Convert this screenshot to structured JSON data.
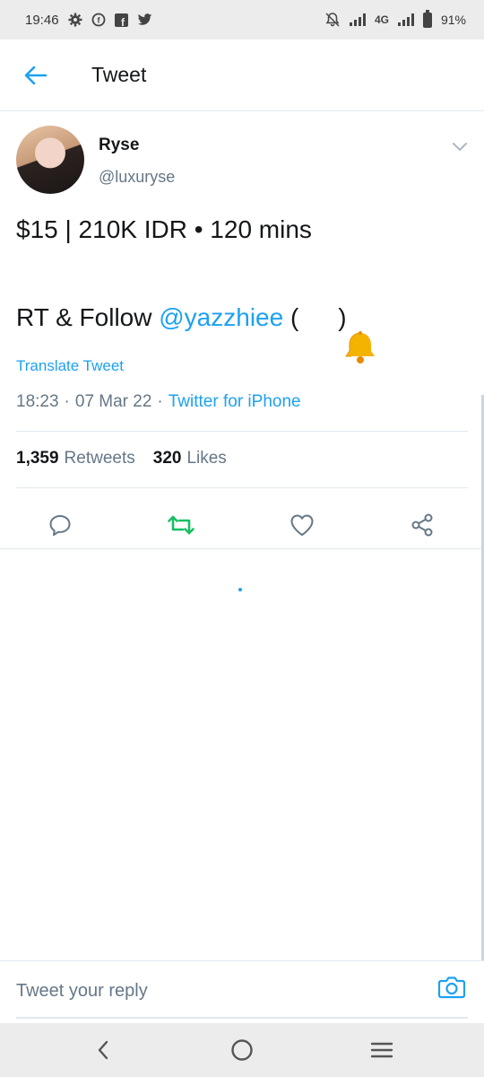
{
  "status_bar": {
    "time": "19:46",
    "network": "4G",
    "battery": "91%",
    "icons": [
      "gear-icon",
      "facebook-messenger-icon",
      "facebook-icon",
      "twitter-icon",
      "mute-icon",
      "signal-icon",
      "battery-icon"
    ]
  },
  "header": {
    "title": "Tweet"
  },
  "tweet": {
    "author_name": "Ryse",
    "author_handle": "@luxuryse",
    "line1": "$15 | 210K IDR • 120 mins",
    "line2_prefix": "RT & Follow ",
    "mention": "@yazzhiee",
    "line2_open": " (",
    "line2_close": ")",
    "translate_label": "Translate Tweet",
    "time": "18:23",
    "date": "07 Mar 22",
    "sep": "·",
    "source": "Twitter for iPhone",
    "retweets_count": "1,359",
    "retweets_label": "Retweets",
    "likes_count": "320",
    "likes_label": "Likes"
  },
  "reply": {
    "placeholder": "Tweet your reply"
  },
  "colors": {
    "accent": "#1da1f2",
    "retweet_green": "#17bf63",
    "secondary_text": "#657786",
    "bell_yellow": "#f5b301"
  }
}
